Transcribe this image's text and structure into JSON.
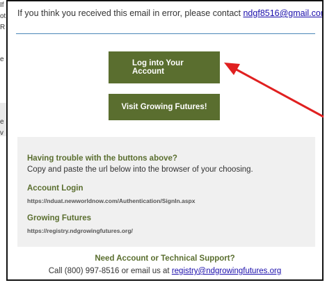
{
  "background_email": {
    "fragments": [
      "If",
      "ot",
      "R",
      "e",
      "e",
      "v"
    ]
  },
  "email": {
    "error_notice": {
      "prefix": "If you think you received this email in error, please contact ",
      "link_text": "ndgf8516@gmail.com",
      "suffix": "."
    },
    "buttons": {
      "login_label": "Log into Your Account",
      "visit_label": "Visit Growing Futures!"
    },
    "help_box": {
      "heading": "Having trouble with the buttons above?",
      "instructions": "Copy and paste the url below into the browser of your choosing.",
      "account_login_heading": "Account Login",
      "account_login_url": "https://nduat.newworldnow.com/Authentication/SignIn.aspx",
      "growing_futures_heading": "Growing Futures",
      "growing_futures_url": "https://registry.ndgrowingfutures.org/"
    },
    "support": {
      "heading": "Need Account or Technical Support?",
      "line_prefix": "Call (800) 997-8516 or email us at ",
      "email_link": "registry@ndgrowingfutures.org"
    }
  },
  "colors": {
    "button_green": "#5a6e2f",
    "heading_green": "#5a6e2f",
    "link_blue": "#1a0dab",
    "help_box_bg": "#f0f0f0",
    "annotation_arrow": "#e02020"
  }
}
